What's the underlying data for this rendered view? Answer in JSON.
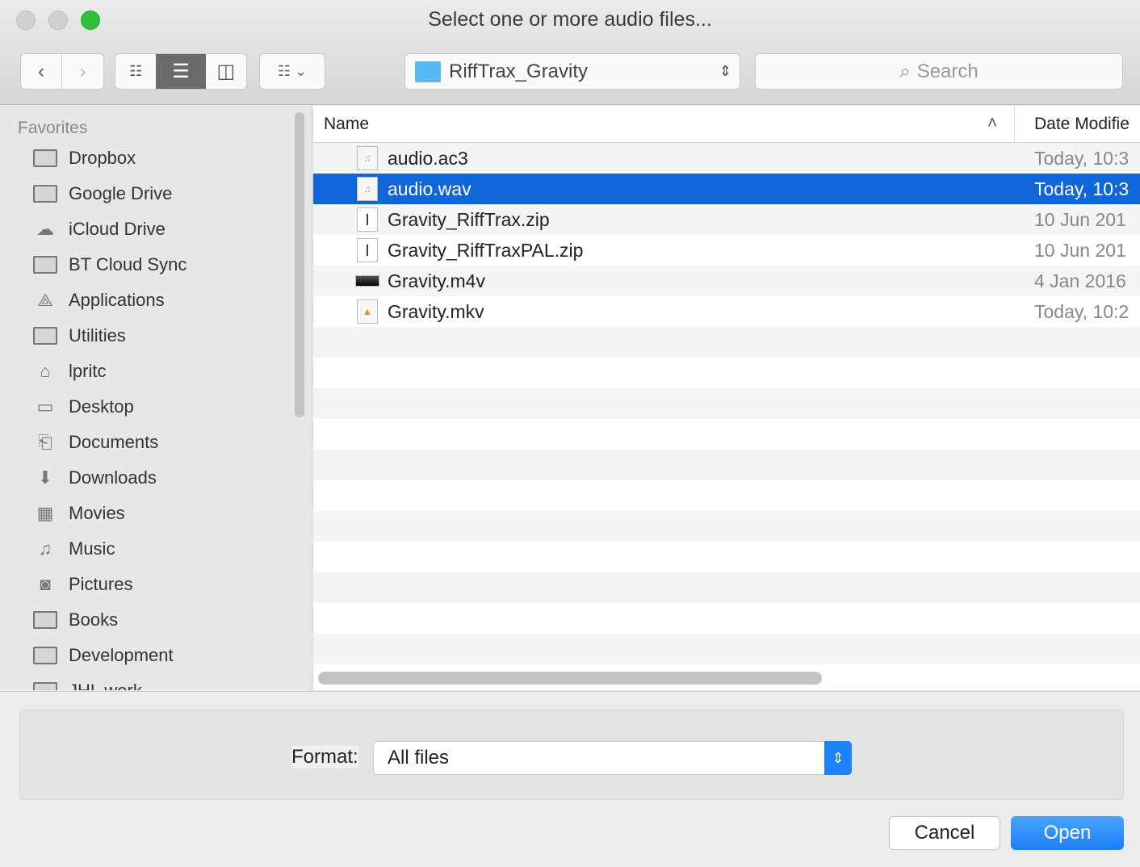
{
  "window": {
    "title": "Select one or more audio files..."
  },
  "toolbar": {
    "location": "RiffTrax_Gravity",
    "search_placeholder": "Search",
    "view_modes": [
      "icon",
      "list",
      "column"
    ],
    "active_view": "list"
  },
  "sidebar": {
    "heading": "Favorites",
    "items": [
      {
        "label": "Dropbox",
        "icon": "folder-icon"
      },
      {
        "label": "Google Drive",
        "icon": "folder-icon"
      },
      {
        "label": "iCloud Drive",
        "icon": "cloud-icon"
      },
      {
        "label": "BT Cloud Sync",
        "icon": "folder-icon"
      },
      {
        "label": "Applications",
        "icon": "applications-icon"
      },
      {
        "label": "Utilities",
        "icon": "folder-icon"
      },
      {
        "label": "lpritc",
        "icon": "home-icon"
      },
      {
        "label": "Desktop",
        "icon": "desktop-icon"
      },
      {
        "label": "Documents",
        "icon": "documents-icon"
      },
      {
        "label": "Downloads",
        "icon": "downloads-icon"
      },
      {
        "label": "Movies",
        "icon": "movies-icon"
      },
      {
        "label": "Music",
        "icon": "music-icon"
      },
      {
        "label": "Pictures",
        "icon": "camera-icon"
      },
      {
        "label": "Books",
        "icon": "folder-icon"
      },
      {
        "label": "Development",
        "icon": "folder-icon"
      },
      {
        "label": "JHL work",
        "icon": "folder-icon"
      }
    ]
  },
  "list": {
    "columns": {
      "name": "Name",
      "date": "Date Modifie"
    },
    "sort": "ascending",
    "files": [
      {
        "name": "audio.ac3",
        "date": "Today, 10:3",
        "selected": false,
        "icon": "audio-file-icon"
      },
      {
        "name": "audio.wav",
        "date": "Today, 10:3",
        "selected": true,
        "icon": "audio-file-icon"
      },
      {
        "name": "Gravity_RiffTrax.zip",
        "date": "10 Jun 201",
        "selected": false,
        "icon": "zip-file-icon"
      },
      {
        "name": "Gravity_RiffTraxPAL.zip",
        "date": "10 Jun 201",
        "selected": false,
        "icon": "zip-file-icon"
      },
      {
        "name": "Gravity.m4v",
        "date": "4 Jan 2016",
        "selected": false,
        "icon": "video-file-icon"
      },
      {
        "name": "Gravity.mkv",
        "date": "Today, 10:2",
        "selected": false,
        "icon": "vlc-file-icon"
      }
    ]
  },
  "footer": {
    "format_label": "Format:",
    "format_value": "All files",
    "cancel": "Cancel",
    "open": "Open"
  },
  "colors": {
    "selection": "#0e66d8",
    "open_button": "#1a82fb",
    "zoom_light": "#2dc13a"
  }
}
